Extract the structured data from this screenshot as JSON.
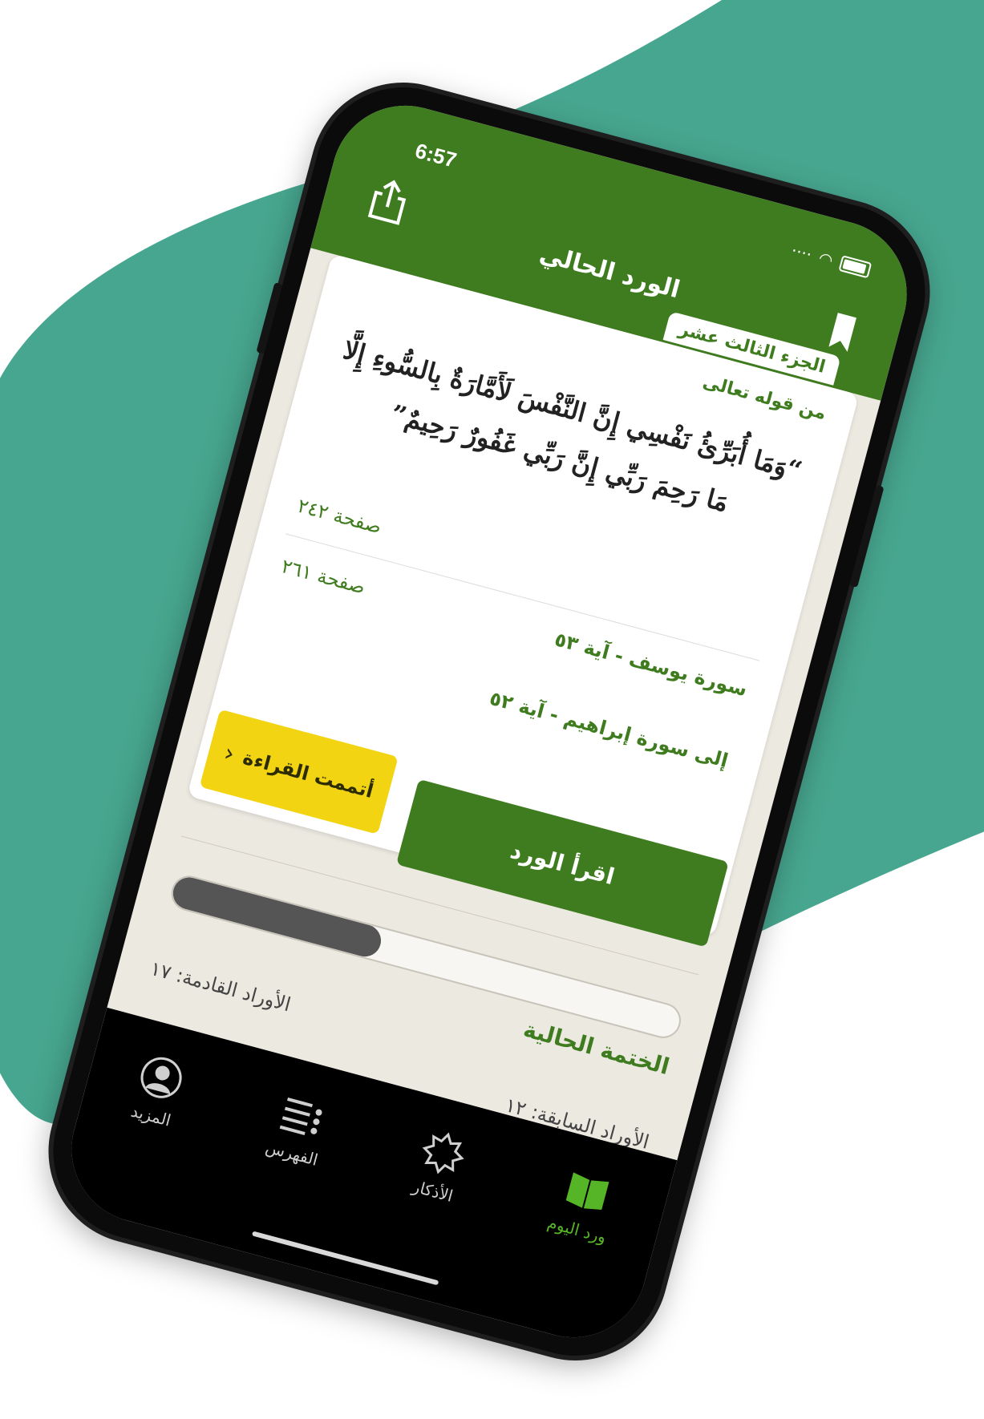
{
  "colors": {
    "accent": "#3f7c1f",
    "yellow": "#f2d413",
    "teal": "#47a68f",
    "tab_active": "#56b527"
  },
  "status_bar": {
    "time": "6:57"
  },
  "header": {
    "title": "الورد الحالي"
  },
  "card": {
    "juz": "الجزء الثالث عشر",
    "from_label": "من قوله تعالى",
    "ayah_line1": "“وَمَا أُبَرِّئُ نَفْسِي إِنَّ النَّفْسَ لَأَمَّارَةٌ بِالسُّوءِ إِلَّا",
    "ayah_line2": "مَا رَحِمَ رَبِّي إِنَّ رَبِّي غَفُورٌ رَحِيمٌ”",
    "start_page": "صفحة ٢٤٢",
    "end_page": "صفحة ٢٦١",
    "from_surah": "سورة يوسف - آية ٥٣",
    "to_surah": "إلى سورة إبراهيم - آية ٥٢"
  },
  "actions": {
    "finished": "أتممت القراءة",
    "read": "اقرأ الورد"
  },
  "khatma": {
    "label": "الختمة الحالية",
    "progress": 0.41,
    "next_label": "الأوراد القادمة: ١٧",
    "prev_label": "الأوراد السابقة: ١٢"
  },
  "tabs": [
    {
      "label": "ورد اليوم",
      "icon": "open-book-icon",
      "active": true
    },
    {
      "label": "الأذكار",
      "icon": "star-badge-icon",
      "active": false
    },
    {
      "label": "الفهرس",
      "icon": "list-icon",
      "active": false
    },
    {
      "label": "المزيد",
      "icon": "person-icon",
      "active": false
    }
  ]
}
